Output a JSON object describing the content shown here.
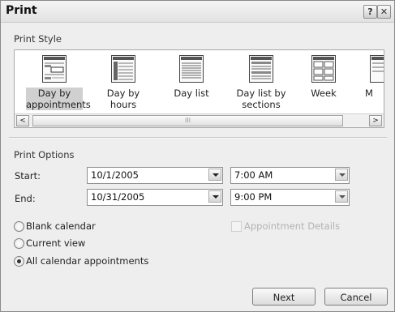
{
  "window": {
    "title": "Print",
    "help_glyph": "?",
    "close_glyph": "✕"
  },
  "print_style": {
    "section_label": "Print Style",
    "items": [
      {
        "label": "Day by appointments",
        "icon": "day-by-appointments-icon",
        "selected": true
      },
      {
        "label": "Day by hours",
        "icon": "day-by-hours-icon"
      },
      {
        "label": "Day list",
        "icon": "day-list-icon"
      },
      {
        "label": "Day list by sections",
        "icon": "day-list-by-sections-icon"
      },
      {
        "label": "Week",
        "icon": "week-icon"
      },
      {
        "label": "M",
        "icon": "month-icon"
      }
    ],
    "scroll_left_glyph": "<",
    "scroll_right_glyph": ">",
    "thumb_grip": "III"
  },
  "print_options": {
    "section_label": "Print Options",
    "start": {
      "label": "Start:",
      "date": "10/1/2005",
      "time": "7:00 AM"
    },
    "end": {
      "label": "End:",
      "date": "10/31/2005",
      "time": "9:00 PM"
    },
    "radios": [
      {
        "label": "Blank calendar",
        "checked": false
      },
      {
        "label": "Current view",
        "checked": false
      },
      {
        "label": "All calendar appointments",
        "checked": true
      }
    ],
    "appointment_details": {
      "label": "Appointment Details",
      "disabled": true
    }
  },
  "buttons": {
    "next": "Next",
    "cancel": "Cancel"
  }
}
